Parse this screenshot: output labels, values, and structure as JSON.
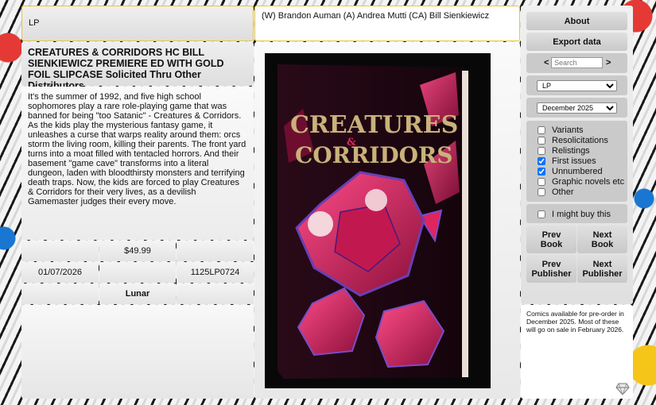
{
  "header": {
    "publisher_filter": "LP",
    "creators": "(W) Brandon Auman (A) Andrea Mutti (CA) Bill Sienkiewicz"
  },
  "book": {
    "title": "CREATURES & CORRIDORS HC BILL SIENKIEWICZ PREMIERE ED WITH GOLD FOIL SLIPCASE Solicited Thru Other Distributors",
    "description": "It's the summer of 1992, and five high school sophomores play a rare role-playing game that was banned for being \"too Satanic\" - Creatures & Corridors. As the kids play the mysterious fantasy game, it unleashes a curse that warps reality around them: orcs storm the living room, killing their parents. The front yard turns into a moat filled with tentacled horrors. And their basement \"game cave\" transforms into a literal dungeon, laden with bloodthirsty monsters and terrifying death traps. Now, the kids are forced to play Creatures & Corridors for their very lives, as a devilish Gamemaster judges their every move.",
    "price": "$49.99",
    "release_date": "01/07/2026",
    "item_code": "1125LP0724",
    "publisher": "Lunar",
    "cover_title_line1": "CREATURES",
    "cover_title_amp": "&",
    "cover_title_line2": "CORRIDORS"
  },
  "sidebar": {
    "about_label": "About",
    "export_label": "Export data",
    "prev_arrow": "<",
    "next_arrow": ">",
    "search_placeholder": "Search",
    "publisher_selected": "LP",
    "month_selected": "December 2025",
    "filters": [
      {
        "label": "Variants",
        "checked": false
      },
      {
        "label": "Resolicitations",
        "checked": false
      },
      {
        "label": "Relistings",
        "checked": false
      },
      {
        "label": "First issues",
        "checked": true
      },
      {
        "label": "Unnumbered",
        "checked": true
      },
      {
        "label": "Graphic novels etc",
        "checked": false
      },
      {
        "label": "Other",
        "checked": false
      }
    ],
    "might_buy_label": "I might buy this",
    "prev_book": "Prev Book",
    "next_book": "Next Book",
    "prev_publisher": "Prev Publisher",
    "next_publisher": "Next Publisher"
  },
  "notice": "Comics available for pre-order in December 2025. Most of these will go on sale in February 2026.",
  "colors": {
    "accent_gold": "#e8c640",
    "button": "#d2d2d2",
    "cover_bg": "#080808",
    "cover_pink": "#d81b5a",
    "cover_title": "#c9b27a",
    "checkbox_blue": "#1a73e8"
  }
}
